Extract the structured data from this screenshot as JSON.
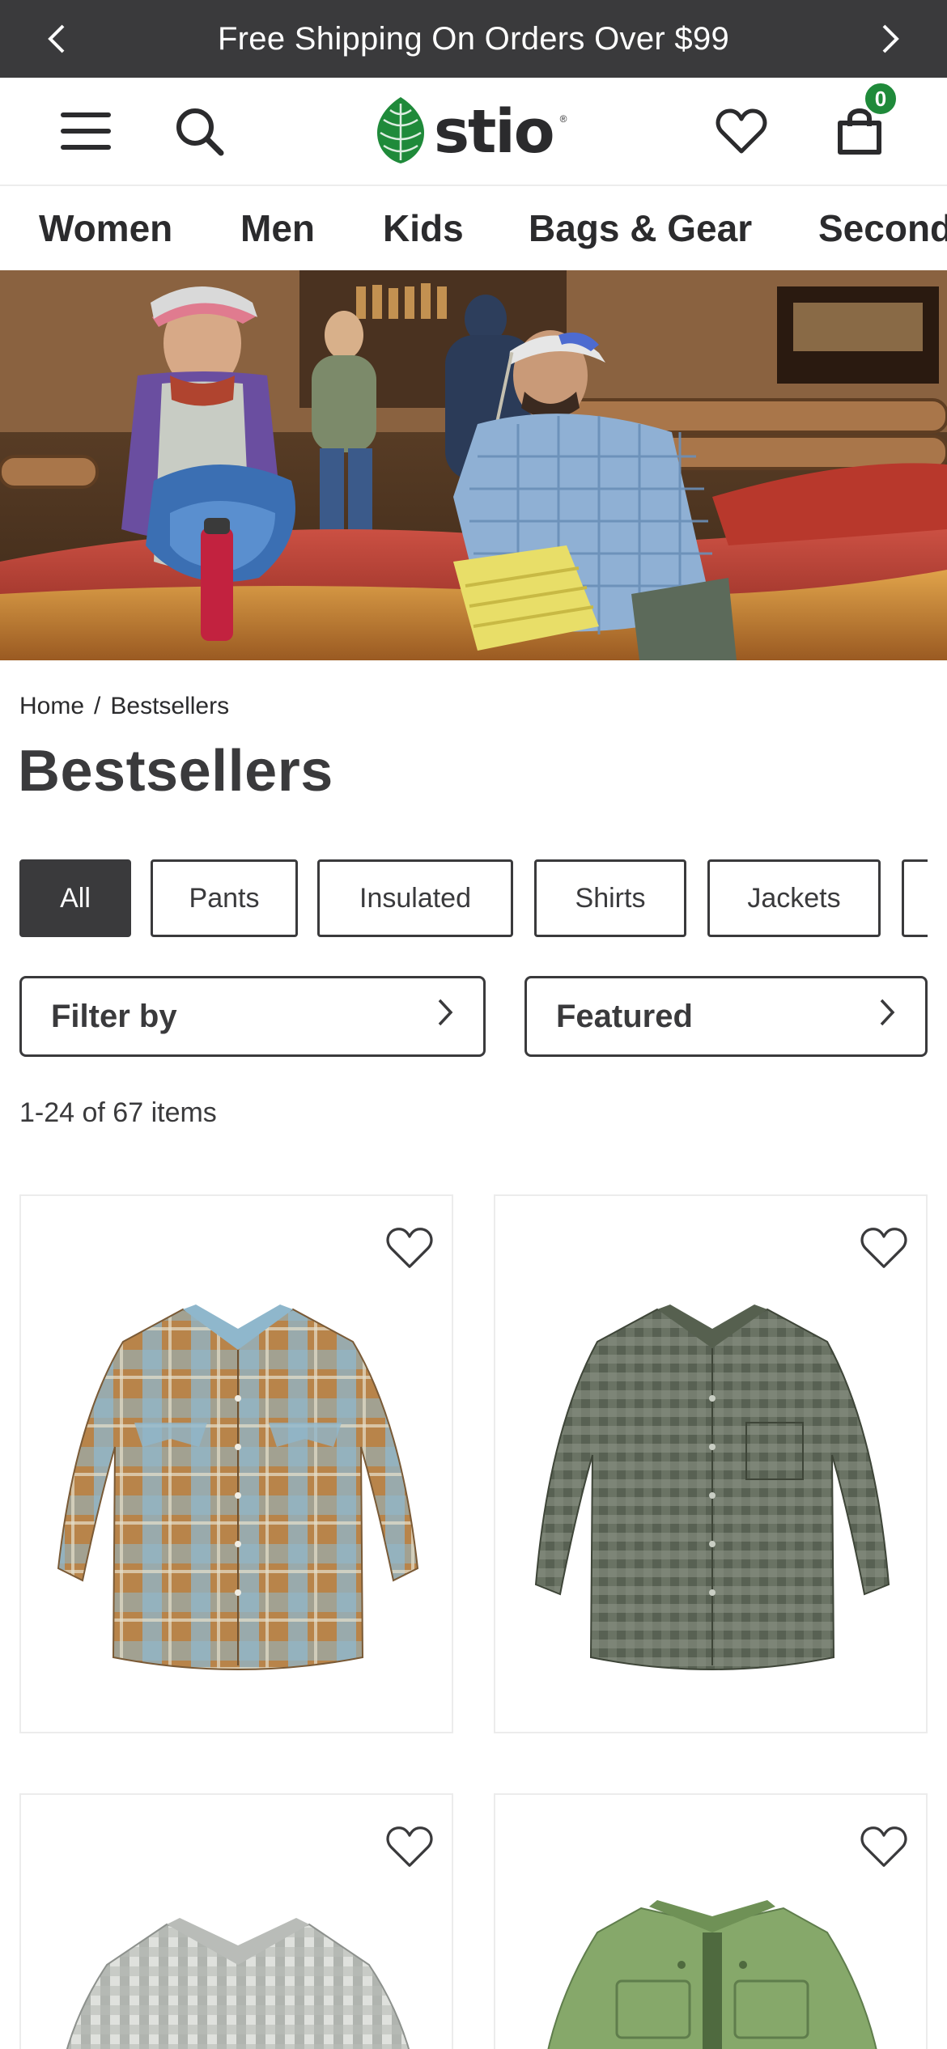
{
  "promo": {
    "text": "Free Shipping On Orders Over $99",
    "prev_icon": "chevron-left-icon",
    "next_icon": "chevron-right-icon"
  },
  "header": {
    "logo_text": "stio",
    "logo_icon": "pinecone-icon",
    "cart_count": "0",
    "icons": [
      "menu-icon",
      "search-icon",
      "heart-icon",
      "bag-icon"
    ]
  },
  "categories": [
    "Women",
    "Men",
    "Kids",
    "Bags & Gear",
    "Second"
  ],
  "breadcrumb": {
    "home": "Home",
    "separator": "/",
    "current": "Bestsellers"
  },
  "page_title": "Bestsellers",
  "chips": {
    "items": [
      "All",
      "Pants",
      "Insulated",
      "Shirts",
      "Jackets"
    ],
    "selected": "All"
  },
  "filter": {
    "label": "Filter by"
  },
  "sort": {
    "label": "Featured"
  },
  "results": {
    "count_text": "1-24 of 67 items"
  },
  "products": [
    {
      "kind": "plaid shirt",
      "colors": {
        "base": "#b8844a",
        "accent": "#8fb7cc"
      }
    },
    {
      "kind": "gingham shirt",
      "colors": {
        "base": "#5d6657",
        "accent": "#8c9486"
      }
    },
    {
      "kind": "check shirt",
      "colors": {
        "base": "#c9ccc8",
        "accent": "#8d918d"
      }
    },
    {
      "kind": "insulated shirt jacket",
      "colors": {
        "base": "#86a86a",
        "accent": "#5f7d4c"
      }
    }
  ],
  "colors": {
    "dark": "#3a3a3c",
    "brand_green": "#1f8a3a",
    "border": "#ececec"
  }
}
